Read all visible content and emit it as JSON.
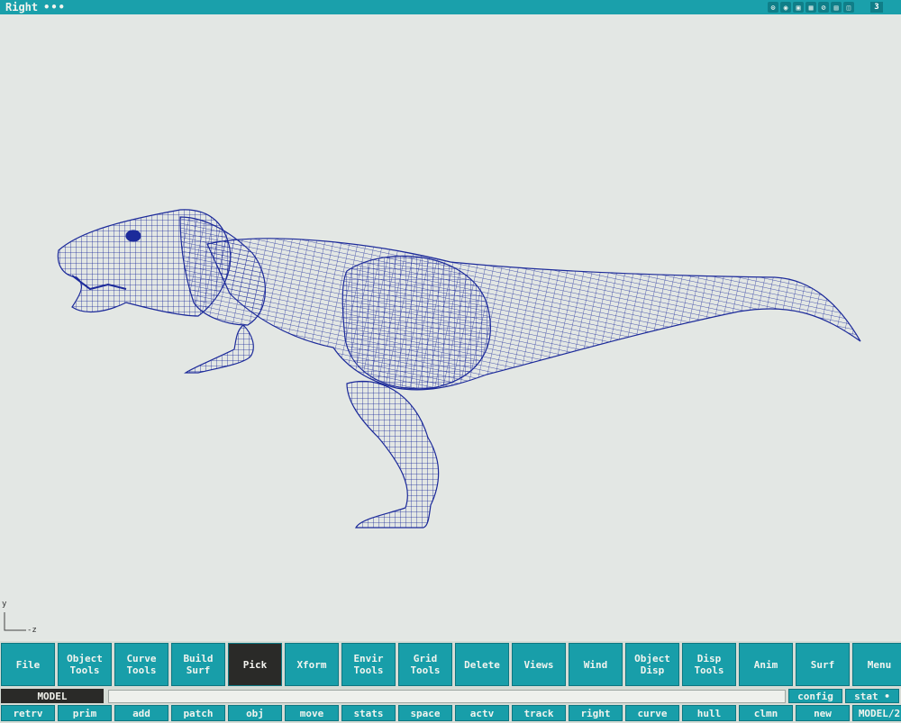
{
  "titlebar": {
    "view_name": "Right",
    "dots": "•••",
    "view_number": "3"
  },
  "title_icons": [
    "⊙",
    "◉",
    "▣",
    "▦",
    "⊘",
    "▤",
    "◫"
  ],
  "viewport": {
    "axis_y": "y",
    "axis_z": "z",
    "wireframe_color": "#1c2a9a"
  },
  "toolbar": {
    "row1": [
      {
        "name": "file-button",
        "label": "File"
      },
      {
        "name": "object-tools-button",
        "label": "Object\nTools"
      },
      {
        "name": "curve-tools-button",
        "label": "Curve\nTools"
      },
      {
        "name": "build-surf-button",
        "label": "Build\nSurf"
      },
      {
        "name": "pick-button",
        "label": "Pick",
        "active": true
      },
      {
        "name": "xform-button",
        "label": "Xform"
      },
      {
        "name": "envir-tools-button",
        "label": "Envir\nTools"
      },
      {
        "name": "grid-tools-button",
        "label": "Grid\nTools"
      },
      {
        "name": "delete-button",
        "label": "Delete"
      },
      {
        "name": "views-button",
        "label": "Views"
      },
      {
        "name": "wind-button",
        "label": "Wind"
      },
      {
        "name": "object-disp-button",
        "label": "Object\nDisp"
      },
      {
        "name": "disp-tools-button",
        "label": "Disp\nTools"
      },
      {
        "name": "anim-button",
        "label": "Anim"
      },
      {
        "name": "surf-button",
        "label": "Surf"
      },
      {
        "name": "menu-button",
        "label": "Menu"
      }
    ],
    "mode_label": "MODEL",
    "command_value": "",
    "config_label": "config",
    "stat_label": "stat •",
    "row3": [
      {
        "name": "retrv-button",
        "label": "retrv"
      },
      {
        "name": "prim-button",
        "label": "prim"
      },
      {
        "name": "add-button",
        "label": "add"
      },
      {
        "name": "patch-button",
        "label": "patch"
      },
      {
        "name": "obj-button",
        "label": "obj"
      },
      {
        "name": "move-button",
        "label": "move"
      },
      {
        "name": "stats-button",
        "label": "stats"
      },
      {
        "name": "space-button",
        "label": "space"
      },
      {
        "name": "actv-button",
        "label": "actv"
      },
      {
        "name": "track-button",
        "label": "track"
      },
      {
        "name": "right-button",
        "label": "right"
      },
      {
        "name": "curve-button",
        "label": "curve"
      },
      {
        "name": "hull-button",
        "label": "hull"
      },
      {
        "name": "clmn-button",
        "label": "clmn"
      },
      {
        "name": "new-button",
        "label": "new"
      },
      {
        "name": "model-page-button",
        "label": "MODEL/2"
      }
    ]
  }
}
